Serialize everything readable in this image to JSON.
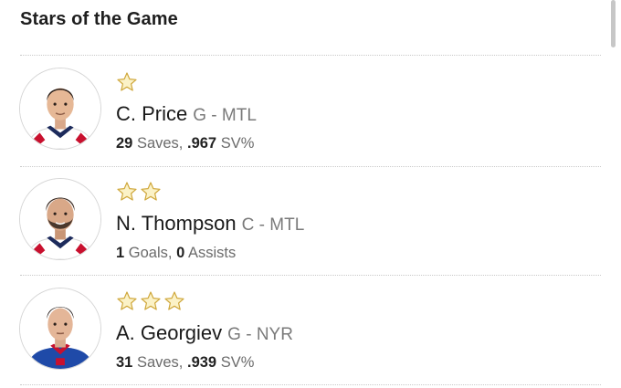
{
  "header": {
    "title": "Stars of the Game"
  },
  "colors": {
    "star_fill": "#fbf2c7",
    "star_stroke": "#cfa73b",
    "divider": "#c9c9c9"
  },
  "players": [
    {
      "stars": 1,
      "star_icon": "star-icon",
      "name": "C. Price",
      "position_team": "G - MTL",
      "stat1_value": "29",
      "stat1_label": "Saves,",
      "stat2_value": ".967",
      "stat2_label": "SV%",
      "avatar": "player-headshot-avatar"
    },
    {
      "stars": 2,
      "star_icon": "star-icon",
      "name": "N. Thompson",
      "position_team": "C - MTL",
      "stat1_value": "1",
      "stat1_label": "Goals,",
      "stat2_value": "0",
      "stat2_label": "Assists",
      "avatar": "player-headshot-avatar"
    },
    {
      "stars": 3,
      "star_icon": "star-icon",
      "name": "A. Georgiev",
      "position_team": "G - NYR",
      "stat1_value": "31",
      "stat1_label": "Saves,",
      "stat2_value": ".939",
      "stat2_label": "SV%",
      "avatar": "player-headshot-avatar"
    }
  ]
}
